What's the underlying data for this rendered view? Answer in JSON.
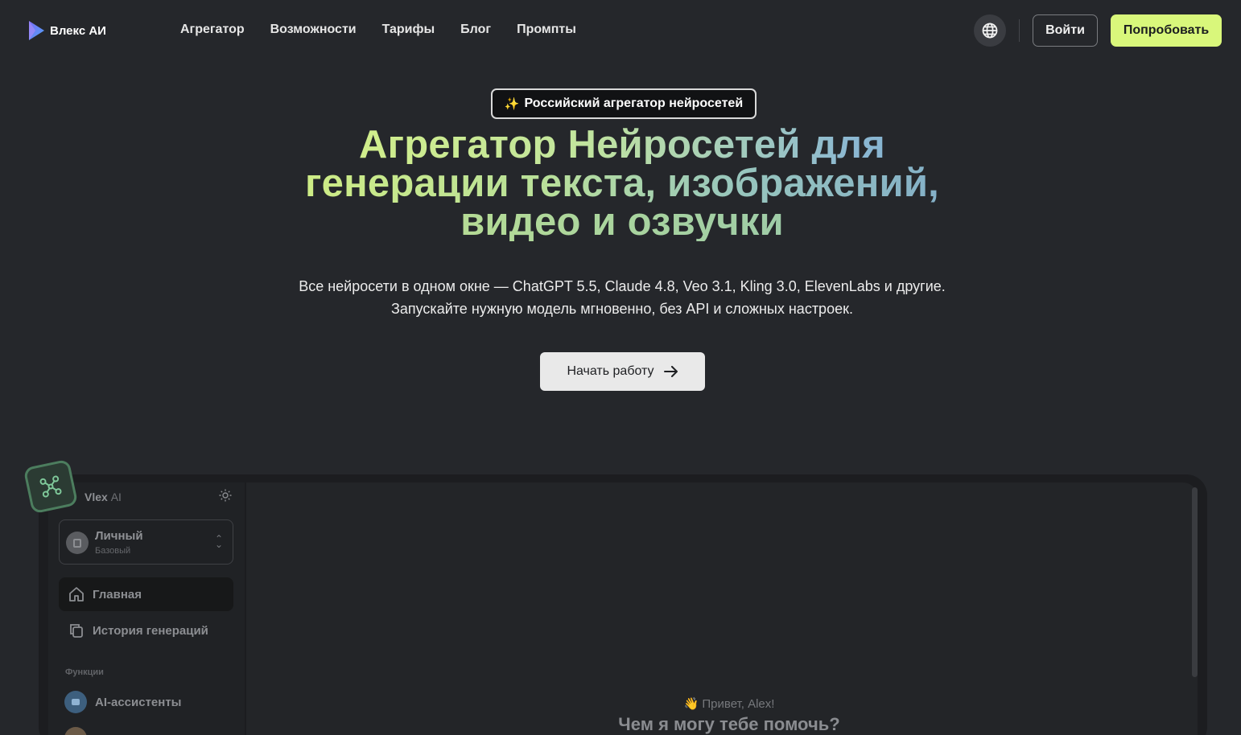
{
  "header": {
    "logo_text": "Влекс АИ",
    "menu": [
      "Агрегатор",
      "Возможности",
      "Тарифы",
      "Блог",
      "Промпты"
    ],
    "globe_icon": "globe-icon",
    "login_label": "Войти",
    "try_label": "Попробовать"
  },
  "hero": {
    "badge": "Российский агрегатор нейросетей",
    "title_lines": [
      "Агрегатор Нейросетей для",
      "генерации текста, изображений,",
      "видео и озвучки"
    ],
    "subtitle_line1": "Все нейросети в одном окне — ChatGPT 5.5, Claude 4.8, Veo 3.1, Kling 3.0, ElevenLabs и другие.",
    "subtitle_line2": "Запускайте нужную модель мгновенно, без API и сложных настроек.",
    "cta_label": "Начать работу"
  },
  "preview": {
    "brand": "Vlex",
    "brand_suffix": "AI",
    "workspace": {
      "name": "Личный",
      "plan": "Базовый"
    },
    "nav": [
      {
        "label": "Главная",
        "icon": "home-icon",
        "active": true
      },
      {
        "label": "История генераций",
        "icon": "copy-icon",
        "active": false
      }
    ],
    "section_label": "Функции",
    "functions": [
      {
        "label": "AI-ассистенты",
        "icon": "chat-icon"
      }
    ],
    "greeting": "👋 Привет, Alex!",
    "question": "Чем я могу тебе помочь?"
  },
  "colors": {
    "background": "#25272b",
    "accent": "#d9f77b",
    "title_gradient_start": "#d8f282",
    "title_gradient_end": "#7ba8cc"
  }
}
